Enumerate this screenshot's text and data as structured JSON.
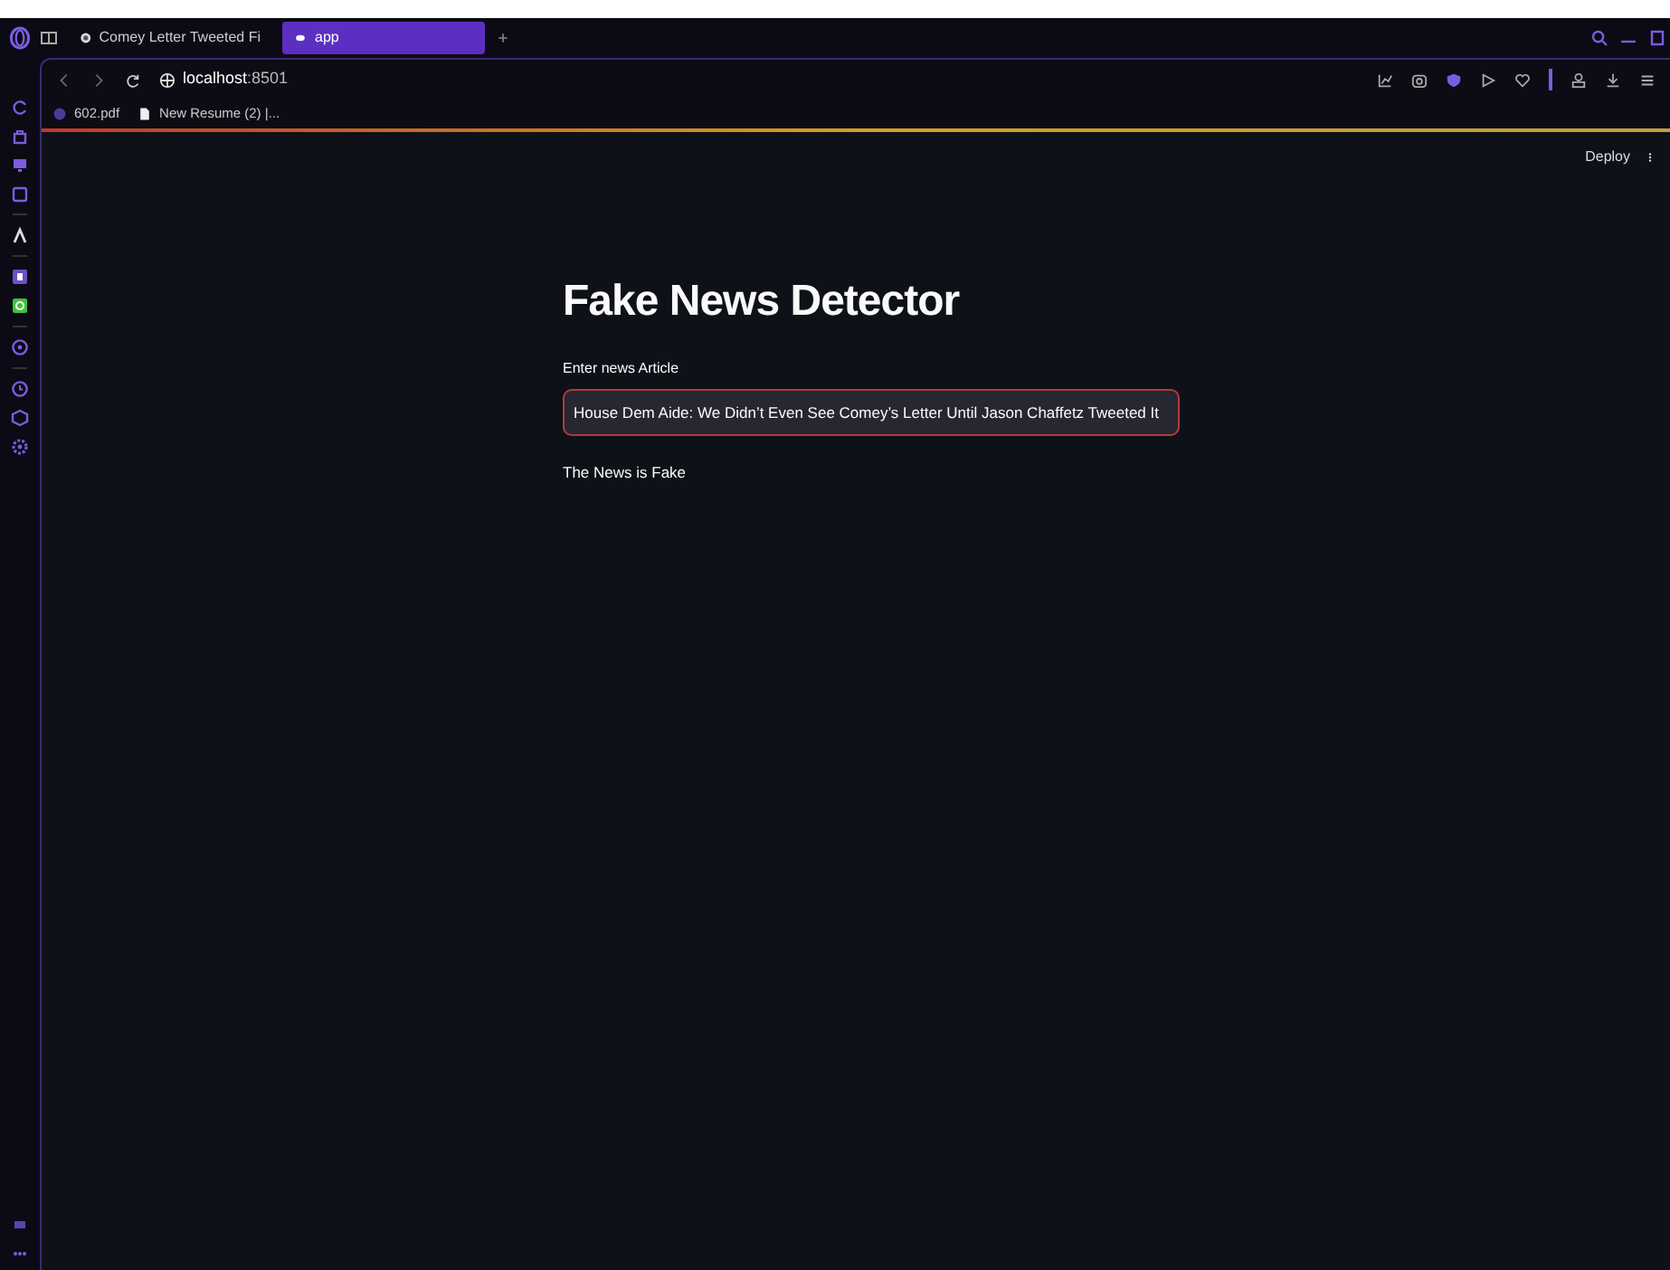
{
  "tabs": [
    {
      "label": "Comey Letter Tweeted Fi",
      "selected": false
    },
    {
      "label": "app",
      "selected": true
    }
  ],
  "address": {
    "host": "localhost",
    "port": ":8501"
  },
  "bookmarks": [
    {
      "label": "602.pdf",
      "kind": "dot"
    },
    {
      "label": "New Resume (2) |...",
      "kind": "doc"
    }
  ],
  "app": {
    "deploy": "Deploy",
    "title": "Fake News Detector",
    "field": {
      "label": "Enter news Article",
      "value": "House Dem Aide: We Didn’t Even See Comey’s Letter Until Jason Chaffetz Tweeted It"
    },
    "result": "The News is Fake"
  }
}
